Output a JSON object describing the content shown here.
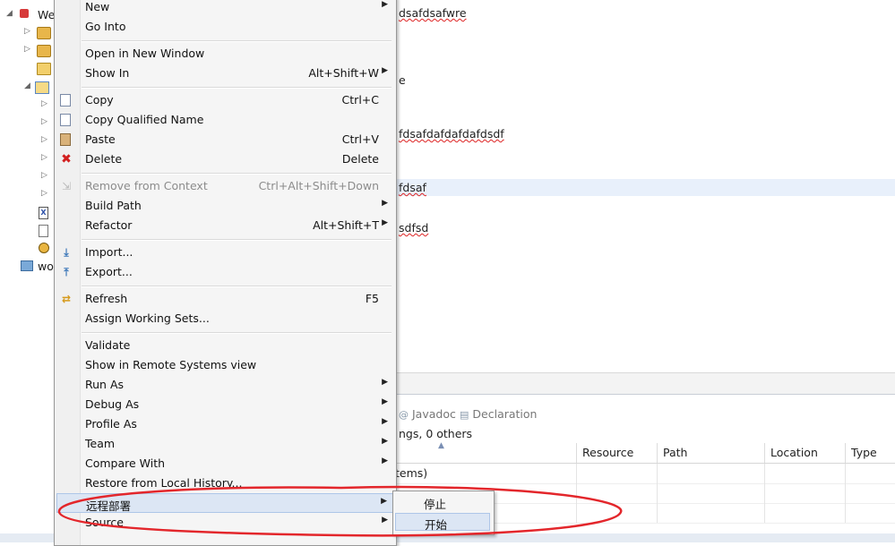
{
  "tree": {
    "project_label": "We",
    "workspace_label": "wo"
  },
  "editor": {
    "lines": [
      {
        "text": "dsafdsafwre"
      },
      {
        "text": "e"
      },
      {
        "text": "fdsafdafdafdafdsdf"
      },
      {
        "text": "fdsaf"
      },
      {
        "text": "sdfsd"
      }
    ]
  },
  "panel": {
    "tabs": [
      {
        "label": "Javadoc",
        "icon": "at-icon"
      },
      {
        "label": "Declaration",
        "icon": "declaration-icon"
      }
    ],
    "summary": "ngs, 0 others",
    "columns": [
      "Resource",
      "Path",
      "Location",
      "Type"
    ],
    "row_text": "tems)"
  },
  "menu": {
    "items": [
      {
        "label": "New",
        "submenu": true
      },
      {
        "label": "Go Into"
      },
      {
        "label": "Open in New Window"
      },
      {
        "label": "Show In",
        "shortcut": "Alt+Shift+W",
        "submenu": true
      },
      {
        "label": "Copy",
        "shortcut": "Ctrl+C",
        "icon": "copy-icon"
      },
      {
        "label": "Copy Qualified Name",
        "icon": "copy-qualified-icon"
      },
      {
        "label": "Paste",
        "shortcut": "Ctrl+V",
        "icon": "paste-icon"
      },
      {
        "label": "Delete",
        "shortcut": "Delete",
        "icon": "delete-icon"
      },
      {
        "label": "Remove from Context",
        "shortcut": "Ctrl+Alt+Shift+Down",
        "disabled": true,
        "icon": "remove-context-icon"
      },
      {
        "label": "Build Path",
        "submenu": true
      },
      {
        "label": "Refactor",
        "shortcut": "Alt+Shift+T",
        "submenu": true
      },
      {
        "label": "Import...",
        "icon": "import-icon"
      },
      {
        "label": "Export...",
        "icon": "export-icon"
      },
      {
        "label": "Refresh",
        "shortcut": "F5",
        "icon": "refresh-icon"
      },
      {
        "label": "Assign Working Sets..."
      },
      {
        "label": "Validate"
      },
      {
        "label": "Show in Remote Systems view"
      },
      {
        "label": "Run As",
        "submenu": true
      },
      {
        "label": "Debug As",
        "submenu": true
      },
      {
        "label": "Profile As",
        "submenu": true
      },
      {
        "label": "Team",
        "submenu": true
      },
      {
        "label": "Compare With",
        "submenu": true
      },
      {
        "label": "Restore from Local History..."
      },
      {
        "label": "远程部署",
        "submenu": true,
        "highlighted": true
      },
      {
        "label": "Source",
        "submenu": true
      }
    ]
  },
  "submenu": {
    "items": [
      {
        "label": "停止"
      },
      {
        "label": "开始",
        "highlighted": true
      }
    ]
  },
  "colors": {
    "annotation": "#e3262b",
    "highlight": "#dce6f4",
    "delete_icon": "#d22020"
  }
}
